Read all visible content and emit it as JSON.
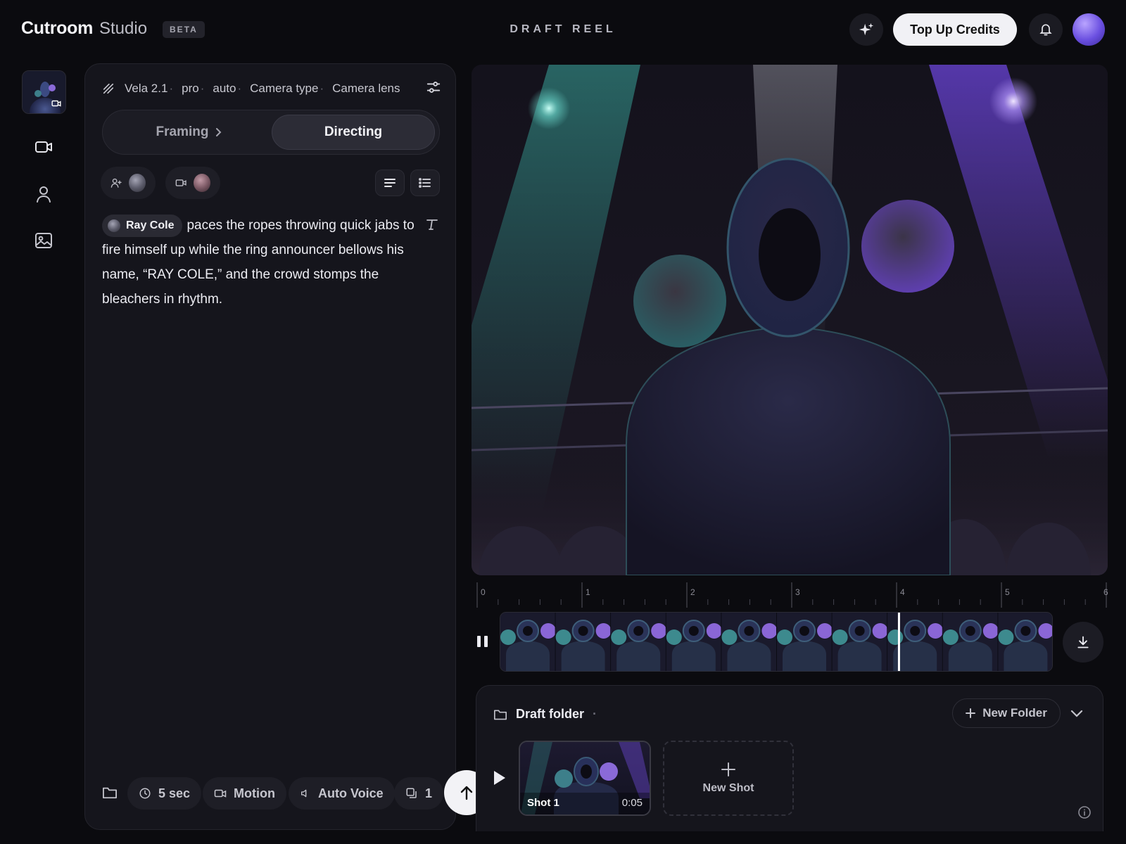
{
  "header": {
    "brand": "Cutroom",
    "brand_suffix": "Studio",
    "badge": "BETA",
    "title": "DRAFT REEL",
    "credits_label": "Top Up Credits"
  },
  "toolbar": {
    "model": "Vela 2.1",
    "quality": "pro",
    "mode": "auto",
    "camera_type": "Camera type",
    "camera_lens": "Camera lens"
  },
  "tabs": [
    {
      "label": "Framing"
    },
    {
      "label": "Directing"
    }
  ],
  "active_tab": "Directing",
  "prompt": {
    "character": "Ray Cole",
    "text": "paces the ropes throwing quick jabs to fire himself up while the ring announcer bellows his name, “RAY COLE,” and the crowd stomps the bleachers in rhythm."
  },
  "bottom": {
    "duration": "5 sec",
    "motion": "Motion",
    "voice": "Auto Voice",
    "count": "1"
  },
  "ruler": {
    "ticks": [
      "0",
      "1",
      "2",
      "3",
      "4",
      "5",
      "6"
    ]
  },
  "playhead_seconds": 4.05,
  "folder": {
    "name": "Draft folder",
    "new_folder": "New Folder",
    "shot_name": "Shot 1",
    "shot_duration": "0:05",
    "new_shot": "New Shot"
  },
  "colors": {
    "accent_purple": "#7a5cf0",
    "accent_teal": "#3aa7a0",
    "background": "#0b0b0f"
  }
}
